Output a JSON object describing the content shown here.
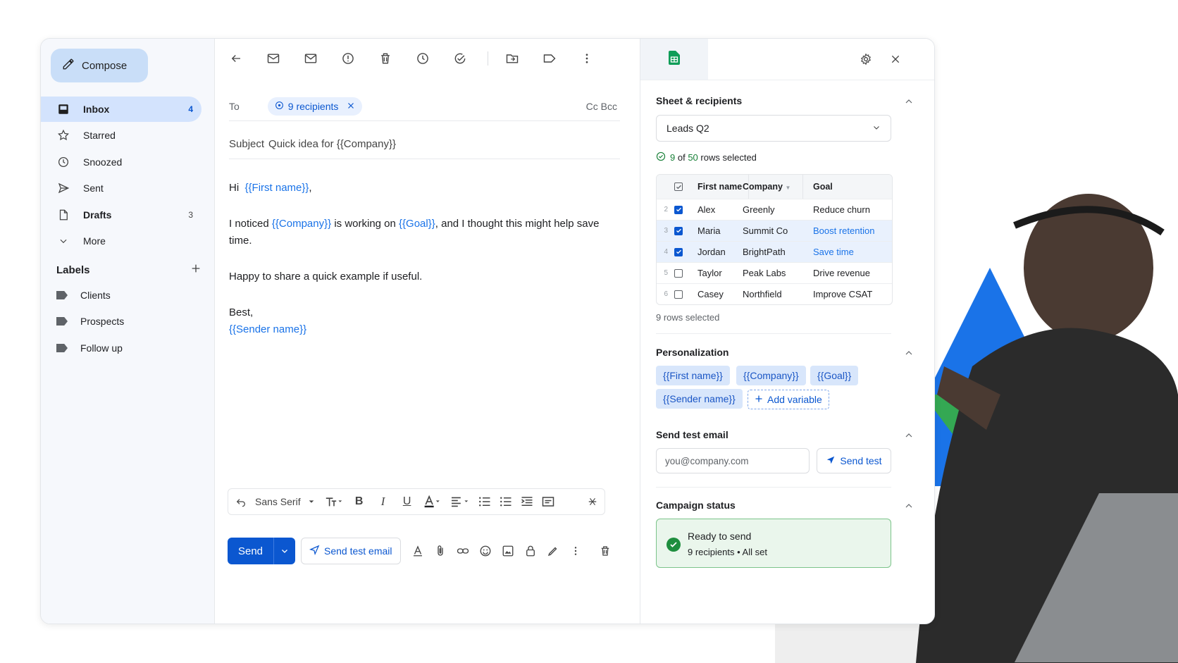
{
  "sidebar": {
    "compose_label": "Compose",
    "items": [
      {
        "label": "Inbox",
        "count": "4"
      },
      {
        "label": "Starred",
        "count": ""
      },
      {
        "label": "Snoozed",
        "count": ""
      },
      {
        "label": "Sent",
        "count": ""
      },
      {
        "label": "Drafts",
        "count": "3"
      },
      {
        "label": "More",
        "count": ""
      }
    ],
    "labels_heading": "Labels",
    "labels": [
      "Clients",
      "Prospects",
      "Follow up"
    ]
  },
  "compose": {
    "to_label": "To",
    "recipients_chip": "9 recipients",
    "cc_bcc": "Cc Bcc",
    "subject_label": "Subject",
    "subject_value": "Quick idea for {{Company}}",
    "greeting": "Hi",
    "var_first_name": "{{First name}}",
    "line1_a": "I noticed",
    "var_company": "{{Company}}",
    "line1_b": "is working on",
    "var_goal": "{{Goal}}",
    "line1_c": ", and I thought this might help save time.",
    "line2": "Happy to share a quick example if useful.",
    "signoff": "Best,",
    "var_sender": "{{Sender name}}",
    "font_name": "Sans Serif",
    "send_label": "Send",
    "send_test_label": "Send test email"
  },
  "panel": {
    "section_sheet": "Sheet & recipients",
    "sheet_name": "Leads Q2",
    "rows_selected_count": "9",
    "rows_of": "of",
    "rows_total": "50",
    "rows_suffix": "rows selected",
    "table": {
      "headers": [
        "First name",
        "Company",
        "Goal"
      ],
      "rows": [
        {
          "num": "2",
          "checked": true,
          "first": "Alex",
          "company": "Greenly",
          "goal": "Reduce churn",
          "highlight": false
        },
        {
          "num": "3",
          "checked": true,
          "first": "Maria",
          "company": "Summit Co",
          "goal": "Boost retention",
          "highlight": true
        },
        {
          "num": "4",
          "checked": true,
          "first": "Jordan",
          "company": "BrightPath",
          "goal": "Save time",
          "highlight": true
        },
        {
          "num": "5",
          "checked": false,
          "first": "Taylor",
          "company": "Peak Labs",
          "goal": "Drive revenue",
          "highlight": false
        },
        {
          "num": "6",
          "checked": false,
          "first": "Casey",
          "company": "Northfield",
          "goal": "Improve CSAT",
          "highlight": false
        }
      ]
    },
    "rows_selected_footer": "9 rows selected",
    "section_personalization": "Personalization",
    "variables": [
      "{{First name}}",
      "{{Company}}",
      "{{Goal}}",
      "{{Sender name}}"
    ],
    "add_variable": "Add variable",
    "section_test": "Send test email",
    "test_placeholder": "you@company.com",
    "send_test_button": "Send test",
    "section_status": "Campaign status",
    "status_title": "Ready to send",
    "status_detail": "9 recipients • All set"
  },
  "colors": {
    "accent": "#0b57d0",
    "variable": "#1a73e8",
    "success": "#1e8e3e"
  }
}
